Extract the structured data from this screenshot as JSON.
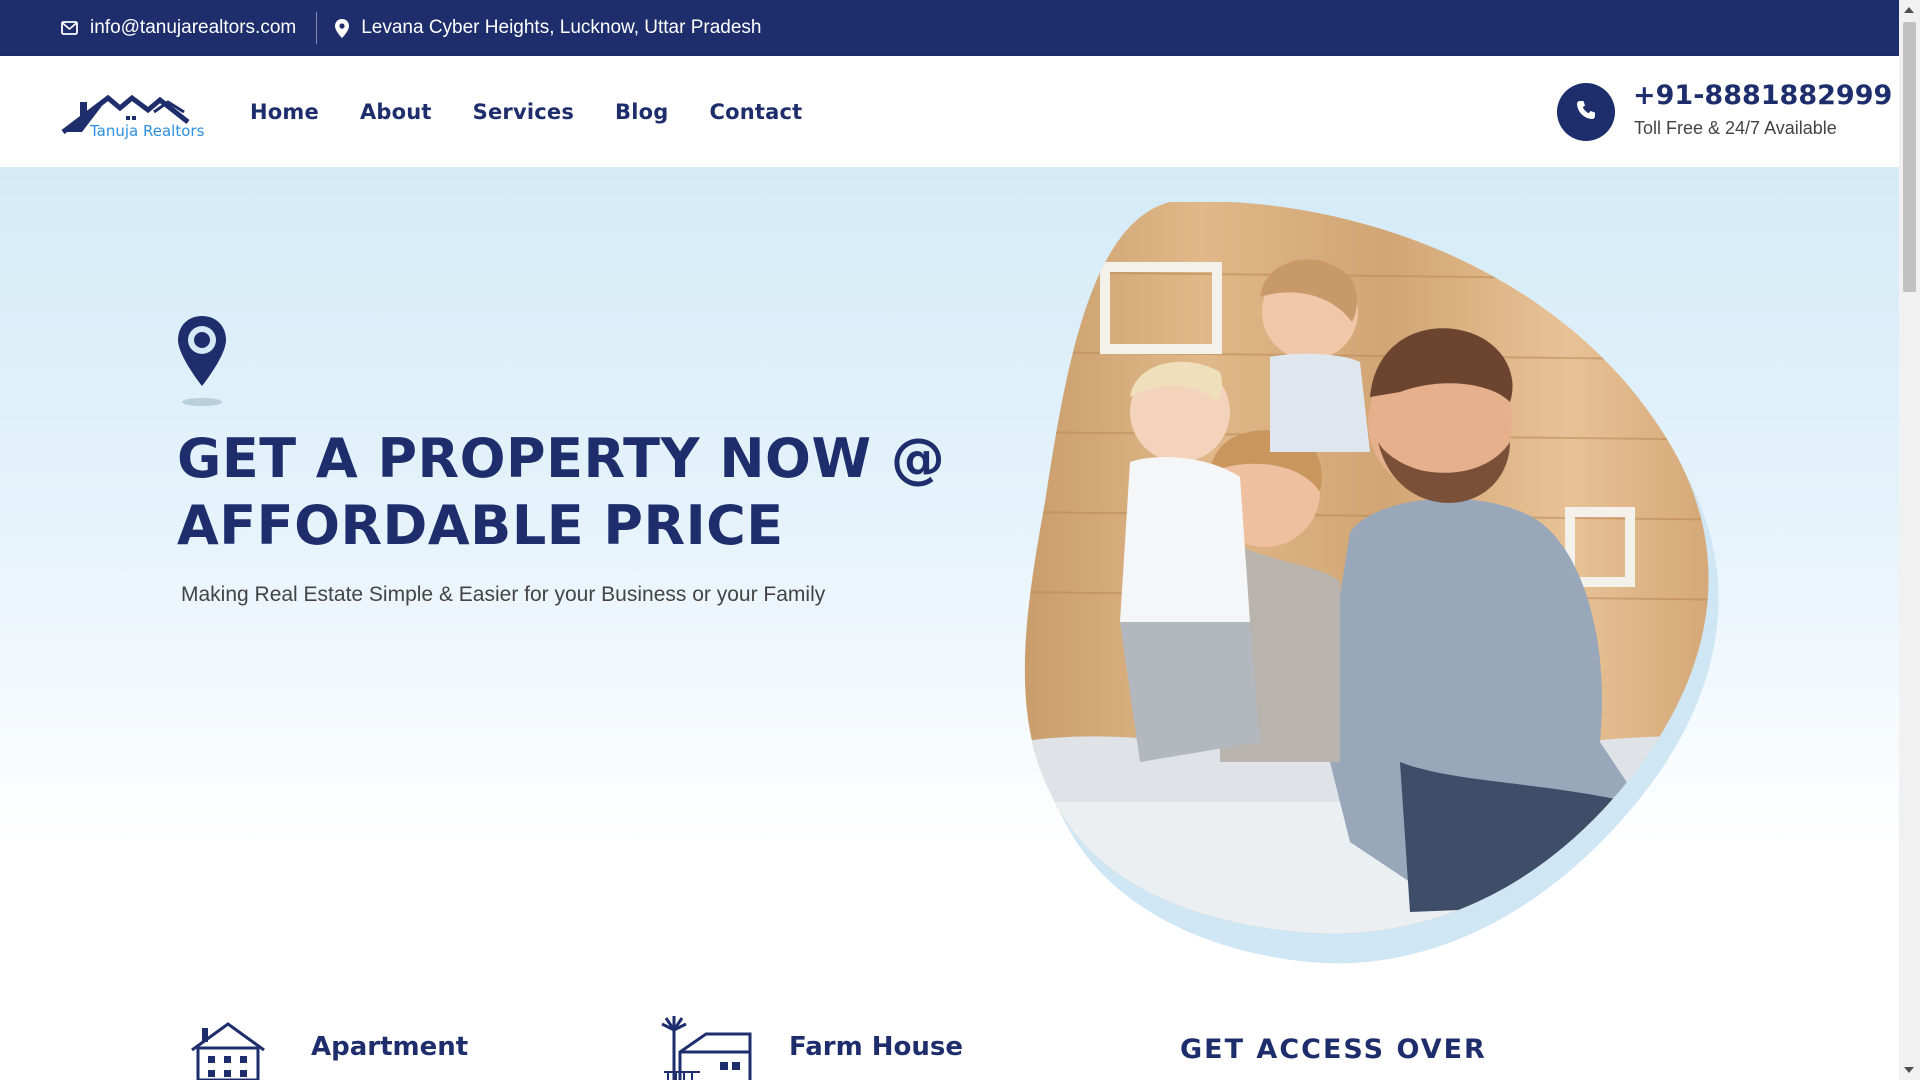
{
  "topbar": {
    "email": "info@tanujarealtors.com",
    "address": "Levana Cyber Heights, Lucknow, Uttar Pradesh",
    "email_icon": "mail-icon",
    "address_icon": "map-pin-icon"
  },
  "header": {
    "logo_text": "Tanuja Realtors",
    "nav": [
      "Home",
      "About",
      "Services",
      "Blog",
      "Contact"
    ],
    "phone": "+91-8881882999",
    "phone_sub": "Toll Free & 24/7 Available",
    "phone_icon": "phone-icon"
  },
  "hero": {
    "title": "GET A PROPERTY NOW @ AFFORDABLE PRICE",
    "subtitle": "Making Real Estate Simple & Easier for your Business or your Family"
  },
  "features": [
    {
      "title": "Apartment",
      "icon": "apartment-icon"
    },
    {
      "title": "Farm House",
      "icon": "farm-house-icon"
    }
  ],
  "access_heading": "GET ACCESS OVER",
  "colors": {
    "brand_navy": "#1e2d6b",
    "accent_blue": "#2d8fe0",
    "hero_bg": "#d4ebf7"
  }
}
